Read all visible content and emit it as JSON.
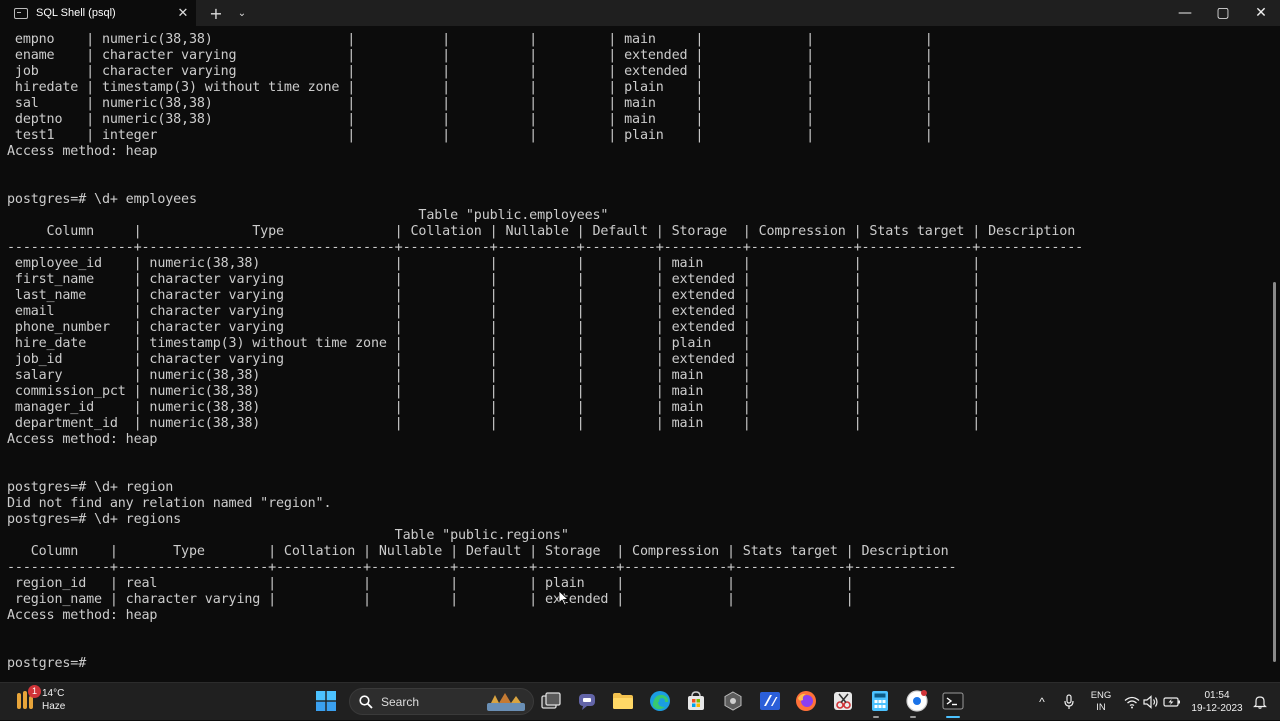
{
  "window": {
    "tab_title": "SQL Shell (psql)",
    "tab_close": "✕",
    "new_tab": "+",
    "dropdown": "⌄",
    "minimize": "—",
    "maximize": "▢",
    "close": "✕"
  },
  "terminal": {
    "lines": [
      " empno    | numeric(38,38)                 |           |          |         | main     |             |              |",
      " ename    | character varying              |           |          |         | extended |             |              |",
      " job      | character varying              |           |          |         | extended |             |              |",
      " hiredate | timestamp(3) without time zone |           |          |         | plain    |             |              |",
      " sal      | numeric(38,38)                 |           |          |         | main     |             |              |",
      " deptno   | numeric(38,38)                 |           |          |         | main     |             |              |",
      " test1    | integer                        |           |          |         | plain    |             |              |",
      "Access method: heap",
      "",
      "",
      "postgres=# \\d+ employees",
      "                                                    Table \"public.employees\"",
      "     Column     |              Type              | Collation | Nullable | Default | Storage  | Compression | Stats target | Description",
      "----------------+--------------------------------+-----------+----------+---------+----------+-------------+--------------+-------------",
      " employee_id    | numeric(38,38)                 |           |          |         | main     |             |              |",
      " first_name     | character varying              |           |          |         | extended |             |              |",
      " last_name      | character varying              |           |          |         | extended |             |              |",
      " email          | character varying              |           |          |         | extended |             |              |",
      " phone_number   | character varying              |           |          |         | extended |             |              |",
      " hire_date      | timestamp(3) without time zone |           |          |         | plain    |             |              |",
      " job_id         | character varying              |           |          |         | extended |             |              |",
      " salary         | numeric(38,38)                 |           |          |         | main     |             |              |",
      " commission_pct | numeric(38,38)                 |           |          |         | main     |             |              |",
      " manager_id     | numeric(38,38)                 |           |          |         | main     |             |              |",
      " department_id  | numeric(38,38)                 |           |          |         | main     |             |              |",
      "Access method: heap",
      "",
      "",
      "postgres=# \\d+ region",
      "Did not find any relation named \"region\".",
      "postgres=# \\d+ regions",
      "                                                 Table \"public.regions\"",
      "   Column    |       Type        | Collation | Nullable | Default | Storage  | Compression | Stats target | Description",
      "-------------+-------------------+-----------+----------+---------+----------+-------------+--------------+-------------",
      " region_id   | real              |           |          |         | plain    |             |              |",
      " region_name | character varying |           |          |         | extended |             |              |",
      "Access method: heap",
      "",
      "",
      "postgres=# "
    ]
  },
  "taskbar": {
    "weather_badge": "1",
    "temperature": "14°C",
    "condition": "Haze",
    "search_label": "Search",
    "lang_line1": "ENG",
    "lang_line2": "IN",
    "time": "01:54",
    "date": "19-12-2023",
    "overflow_chevron": "^"
  },
  "colors": {
    "terminal_bg": "#0c0c0c",
    "terminal_fg": "#cccccc",
    "titlebar_bg": "#1f1f1f",
    "taskbar_bg": "#202020"
  }
}
